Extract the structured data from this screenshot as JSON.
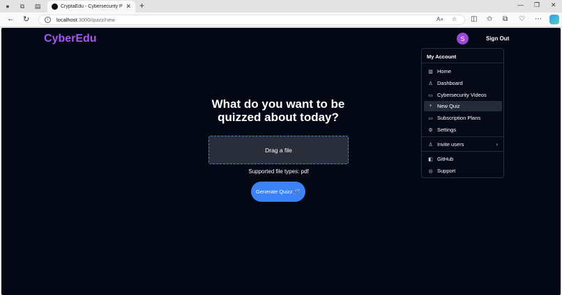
{
  "browser": {
    "tab_title": "CryptaEdu - Cybersecurity Preven",
    "url_host": "localhost",
    "url_path": ":3000/quizz/new",
    "icons": [
      "profile-icon",
      "workspaces-icon",
      "vertical-tabs-icon",
      "new-tab-icon",
      "back-icon",
      "refresh-icon",
      "read-aloud-icon",
      "favorite-icon",
      "split-screen-icon",
      "favorites-icon",
      "collections-icon",
      "browser-essentials-icon",
      "more-icon",
      "copilot-icon"
    ]
  },
  "header": {
    "brand": "CyberEdu",
    "avatar_letter": "S",
    "sign_out": "Sign Out"
  },
  "main": {
    "heading": "What do you want to be quizzed about today?",
    "dropzone_label": "Drag a file",
    "supported_types": "Supported file types: pdf",
    "generate_button": "Generate Quizz 🪄"
  },
  "menu": {
    "title": "My Account",
    "items": [
      {
        "label": "Home",
        "icon": "chart-icon"
      },
      {
        "label": "Dashboard",
        "icon": "user-icon"
      },
      {
        "label": "Cybersecurity Videos",
        "icon": "video-icon"
      },
      {
        "label": "New Quiz",
        "icon": "plus-icon"
      },
      {
        "label": "Subscription Plans",
        "icon": "credit-card-icon"
      },
      {
        "label": "Settings",
        "icon": "gear-icon"
      },
      {
        "label": "Invite users",
        "icon": "user-plus-icon"
      },
      {
        "label": "GitHub",
        "icon": "github-icon"
      },
      {
        "label": "Support",
        "icon": "support-icon"
      }
    ]
  },
  "colors": {
    "brand": "#a855f7",
    "accent": "#3b82f6",
    "background": "#040714"
  }
}
